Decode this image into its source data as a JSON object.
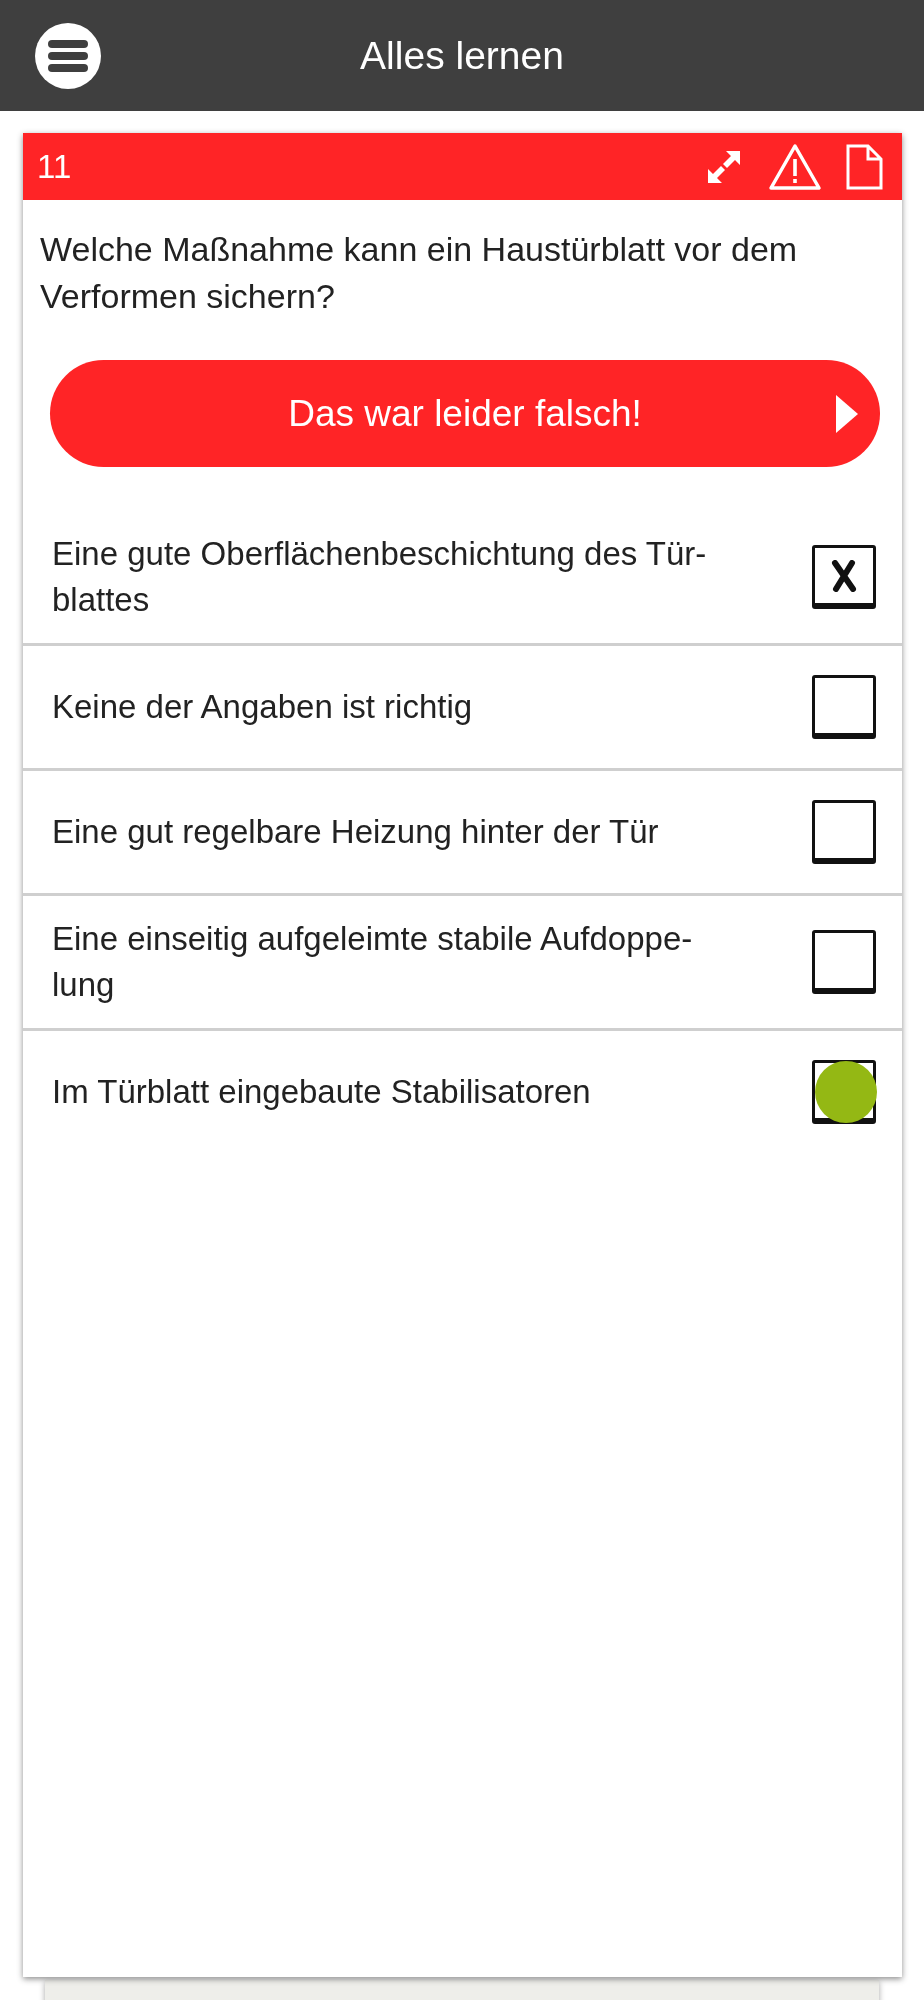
{
  "app_bar": {
    "title": "Alles lernen"
  },
  "card": {
    "number": "11",
    "question": "Welche Maßnahme kann ein Haustürblatt vor dem Verformen sichern?",
    "result": {
      "kind": "wrong",
      "label": "Das war leider falsch!"
    },
    "answers": [
      {
        "text": "Eine gute Oberflächenbeschichtung des Tür-\nblattes",
        "checked": true,
        "correct": false
      },
      {
        "text": "Keine der Angaben ist richtig",
        "checked": false,
        "correct": false
      },
      {
        "text": "Eine gut regelbare Heizung hinter der Tür",
        "checked": false,
        "correct": false
      },
      {
        "text": "Eine einseitig aufgeleimte stabile Aufdoppe-\nlung",
        "checked": false,
        "correct": false
      },
      {
        "text": "Im Türblatt eingebaute Stabilisatoren",
        "checked": false,
        "correct": true
      }
    ]
  }
}
